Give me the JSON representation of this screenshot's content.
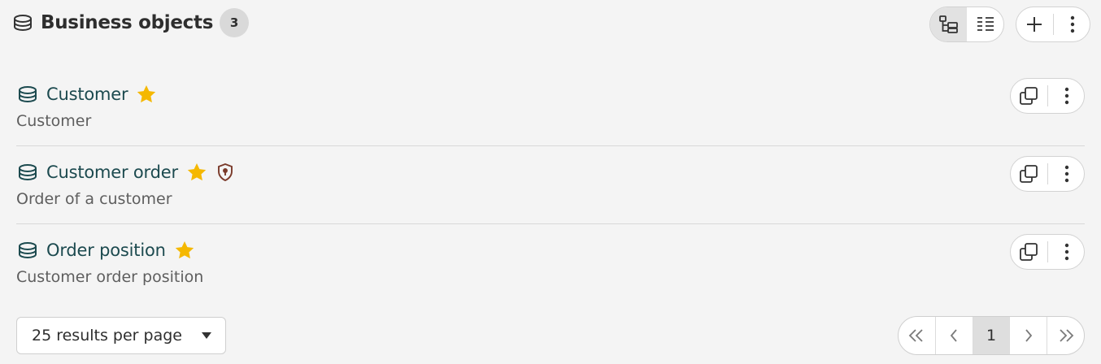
{
  "header": {
    "title": "Business objects",
    "count": "3",
    "icon": "database-icon"
  },
  "view_toggle": {
    "options": [
      "tree-view-icon",
      "list-view-icon"
    ],
    "active": "tree-view-icon"
  },
  "header_actions": [
    "plus-icon",
    "more-vertical-icon"
  ],
  "items": [
    {
      "title": "Customer",
      "description": "Customer",
      "favorite": true,
      "protected": false
    },
    {
      "title": "Customer order",
      "description": "Order of a customer",
      "favorite": true,
      "protected": true
    },
    {
      "title": "Order position",
      "description": "Customer order position",
      "favorite": true,
      "protected": false
    }
  ],
  "row_actions": [
    "copy-icon",
    "more-vertical-icon"
  ],
  "footer": {
    "per_page_label": "25 results per page",
    "current_page": "1"
  },
  "colors": {
    "title_teal": "#1c4a4f",
    "star": "#f5b800",
    "shield": "#7a3a2a",
    "background": "#f4f4f4"
  }
}
